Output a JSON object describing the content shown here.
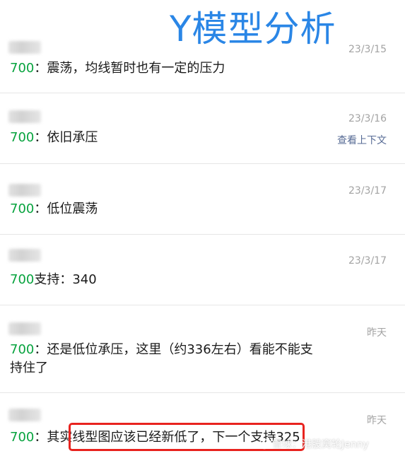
{
  "overlay_title": "Y模型分析",
  "messages": [
    {
      "date": "23/3/15",
      "ticker": "700",
      "text": "：震荡，均线暂时也有一定的压力"
    },
    {
      "date": "23/3/16",
      "ticker": "700",
      "text": "：依旧承压",
      "context_link": "查看上下文"
    },
    {
      "date": "23/3/17",
      "ticker": "700",
      "text": "：低位震荡"
    },
    {
      "date": "23/3/17",
      "ticker": "700",
      "text": "支持：340"
    },
    {
      "date": "昨天",
      "ticker": "700",
      "text": "：还是低位承压，这里（约336左右）看能不能支持住了"
    },
    {
      "date": "昨天",
      "ticker": "700",
      "text": "：其实线型图应该已经新低了，下一个支持325"
    }
  ],
  "watermark": "雪球：港股窝轮Jenny",
  "colors": {
    "ticker": "#07a33e",
    "title": "#2a86e6",
    "highlight": "#e8231f",
    "link": "#576b95"
  }
}
